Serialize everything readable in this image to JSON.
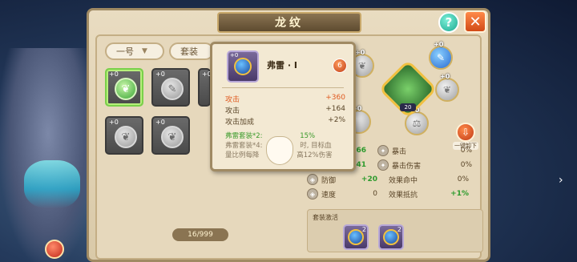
{
  "header": {
    "title": "龙纹",
    "help": "?",
    "close": "✕"
  },
  "filters": {
    "slot_select": "一号",
    "set_select": "套装"
  },
  "inventory": {
    "slots": [
      {
        "level": "+0",
        "icon": "leaf",
        "selected": true
      },
      {
        "level": "+0",
        "icon": "feather",
        "selected": false
      },
      {
        "level": "+0",
        "icon": "feather",
        "selected": false
      },
      {
        "level": "+0",
        "icon": "leaf",
        "selected": false
      },
      {
        "level": "+0",
        "icon": "leaf",
        "selected": false
      }
    ],
    "count": "16/999"
  },
  "wheel": {
    "center_level": "20",
    "orbs": [
      {
        "level": "+0"
      },
      {
        "level": "+0"
      },
      {
        "level": "+0"
      },
      {
        "level": "+0"
      },
      {
        "level": "+0"
      }
    ],
    "side_button_label": "一键卸下"
  },
  "stats": [
    {
      "name": "",
      "value": "+866",
      "name2": "暴击",
      "value2": "0%"
    },
    {
      "name": "",
      "value": "+641",
      "name2": "暴击伤害",
      "value2": "0%"
    },
    {
      "name": "防御",
      "value": "+20",
      "name2": "效果命中",
      "value2": "0%"
    },
    {
      "name": "速度",
      "value": "0",
      "name2": "效果抵抗",
      "value2": "+1%"
    }
  ],
  "set_bonus": {
    "title": "套装激活",
    "gems": [
      {
        "count": "2"
      },
      {
        "count": "2"
      }
    ]
  },
  "tooltip": {
    "level": "+0",
    "name": "弗雷 · I",
    "badge": "6",
    "main_stat": {
      "label": "攻击",
      "value": "+360"
    },
    "sub_stats": [
      {
        "label": "攻击",
        "value": "+164"
      },
      {
        "label": "攻击加成",
        "value": "+2%"
      }
    ],
    "set_line_1": "弗雷套装*2:",
    "set_line_1_suffix": "15%",
    "set_line_2": "弗雷套装*4:",
    "set_line_2_suffix": "时, 目标血",
    "set_line_3": "量比例每降",
    "set_line_3_suffix": "高12%伤害"
  },
  "colors": {
    "accent_green": "#2c9a2c",
    "accent_orange": "#e05a20",
    "panel": "#e6d8bc"
  }
}
